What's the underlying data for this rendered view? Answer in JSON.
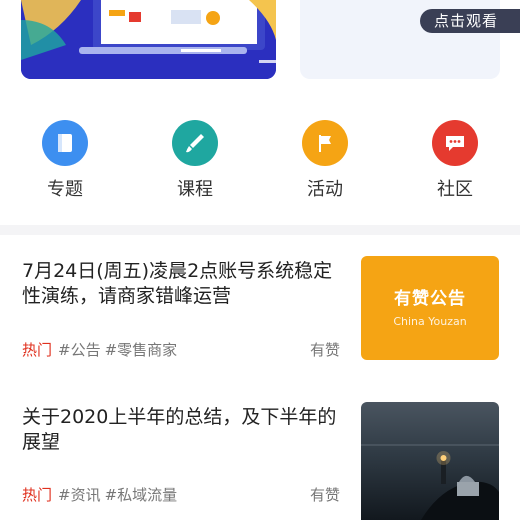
{
  "banner": {
    "watch_label": "点击观看"
  },
  "nav": [
    {
      "label": "专题",
      "icon": "book-icon",
      "color": "#3d8ff0"
    },
    {
      "label": "课程",
      "icon": "brush-icon",
      "color": "#1fa7a0"
    },
    {
      "label": "活动",
      "icon": "flag-icon",
      "color": "#f5a414"
    },
    {
      "label": "社区",
      "icon": "chat-icon",
      "color": "#e53a2f"
    }
  ],
  "articles": [
    {
      "title": "7月24日(周五)凌晨2点账号系统稳定性演练，请商家错峰运营",
      "hot": "热门",
      "tags": [
        "#公告",
        "#零售商家"
      ],
      "author": "有赞",
      "thumb_title": "有赞公告",
      "thumb_subtitle": "China Youzan"
    },
    {
      "title": "关于2020上半年的总结，及下半年的展望",
      "hot": "热门",
      "tags": [
        "#资讯",
        "#私域流量"
      ],
      "author": "有赞"
    }
  ],
  "colors": {
    "hot": "#e0301e",
    "notice_bg": "#f5a414",
    "banner_bg": "#2b2fbf"
  }
}
